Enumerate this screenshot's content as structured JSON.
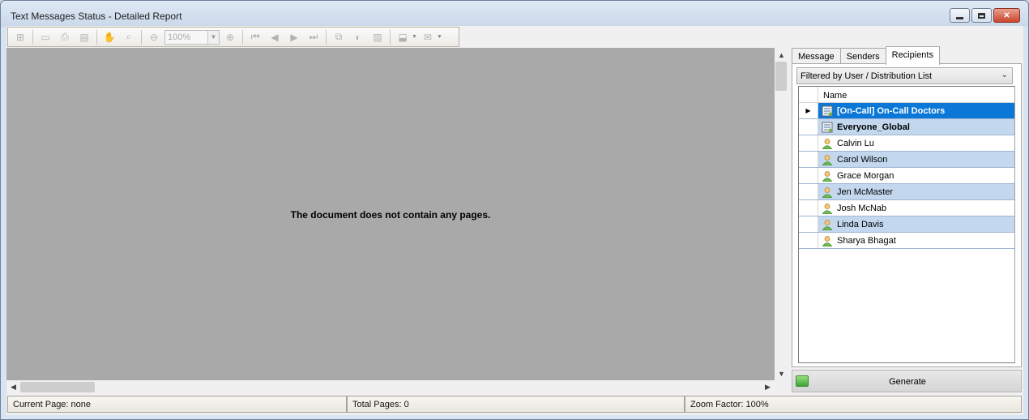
{
  "window": {
    "title": "Text Messages Status - Detailed Report"
  },
  "toolbar": {
    "zoom_value": "100%"
  },
  "preview": {
    "empty_message": "The document does not contain any pages."
  },
  "status": {
    "current_page": "Current Page: none",
    "total_pages": "Total Pages: 0",
    "zoom_factor": "Zoom Factor: 100%"
  },
  "tabs": [
    {
      "label": "Message"
    },
    {
      "label": "Senders"
    },
    {
      "label": "Recipients"
    }
  ],
  "filter": {
    "selected": "Filtered by User / Distribution List"
  },
  "grid": {
    "column": "Name",
    "rows": [
      {
        "name": "[On-Call] On-Call Doctors",
        "type": "list"
      },
      {
        "name": "Everyone_Global",
        "type": "list"
      },
      {
        "name": "Calvin Lu",
        "type": "user"
      },
      {
        "name": "Carol Wilson",
        "type": "user"
      },
      {
        "name": "Grace Morgan",
        "type": "user"
      },
      {
        "name": "Jen McMaster",
        "type": "user"
      },
      {
        "name": "Josh McNab",
        "type": "user"
      },
      {
        "name": "Linda Davis",
        "type": "user"
      },
      {
        "name": "Sharya Bhagat",
        "type": "user"
      }
    ]
  },
  "generate": {
    "label": "Generate"
  },
  "colors": {
    "selected_row": "#0b78d7",
    "alt_row": "#c3d8ef",
    "preview_bg": "#a9a9a9"
  }
}
